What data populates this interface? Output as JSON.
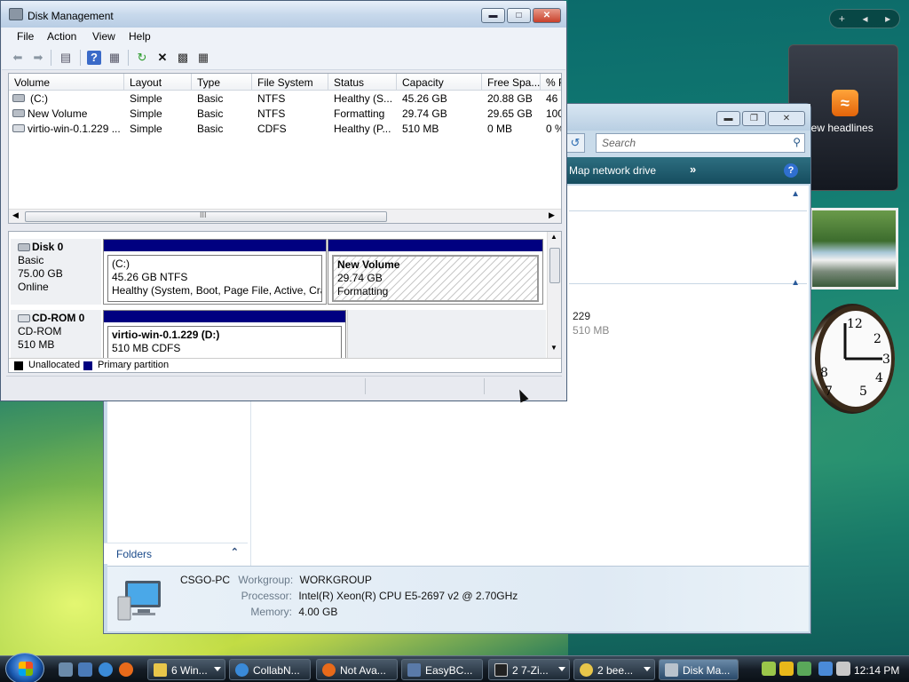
{
  "sidebar": {
    "controls": {
      "add": "+",
      "prev": "◂",
      "next": "▸"
    },
    "news_label": "iew headlines",
    "colors": {
      "rss": "#f08a1a"
    }
  },
  "explorer": {
    "search_placeholder": "Search",
    "map_network": "Map network drive",
    "more": "»",
    "help": "?",
    "drive_line1": "229",
    "drive_line2": "510 MB",
    "folders_label": "Folders",
    "details": {
      "name": "CSGO-PC",
      "workgroup_label": "Workgroup:",
      "workgroup": "WORKGROUP",
      "processor_label": "Processor:",
      "processor": "Intel(R) Xeon(R) CPU E5-2697 v2 @ 2.70GHz",
      "memory_label": "Memory:",
      "memory": "4.00 GB"
    }
  },
  "disk_mgmt": {
    "title": "Disk Management",
    "menu": [
      "File",
      "Action",
      "View",
      "Help"
    ],
    "toolbar_icons": [
      "back-icon",
      "forward-icon",
      "up-pane-icon",
      "help-icon",
      "view-icon",
      "refresh-icon",
      "delete-icon",
      "properties-icon",
      "rescan-icon"
    ],
    "columns": [
      "Volume",
      "Layout",
      "Type",
      "File System",
      "Status",
      "Capacity",
      "Free Spa...",
      "% F"
    ],
    "volumes": [
      {
        "volume": "(C:)",
        "layout": "Simple",
        "type": "Basic",
        "fs": "NTFS",
        "status": "Healthy (S...",
        "capacity": "45.26 GB",
        "free": "20.88 GB",
        "pct": "46"
      },
      {
        "volume": "New Volume",
        "layout": "Simple",
        "type": "Basic",
        "fs": "NTFS",
        "status": "Formatting",
        "capacity": "29.74 GB",
        "free": "29.65 GB",
        "pct": "100"
      },
      {
        "volume": "virtio-win-0.1.229 ...",
        "layout": "Simple",
        "type": "Basic",
        "fs": "CDFS",
        "status": "Healthy (P...",
        "capacity": "510 MB",
        "free": "0 MB",
        "pct": "0 %"
      }
    ],
    "scroll_grip": "III",
    "disks": [
      {
        "name": "Disk 0",
        "kind": "Basic",
        "size": "75.00 GB",
        "state": "Online"
      },
      {
        "name": "CD-ROM 0",
        "kind": "CD-ROM",
        "size": "510 MB",
        "state": ""
      }
    ],
    "partitions": {
      "c": {
        "title": "(C:)",
        "line2": "45.26 GB NTFS",
        "line3": "Healthy (System, Boot, Page File, Active, Cras"
      },
      "newvol": {
        "title": "New Volume",
        "line2": "29.74 GB",
        "line3": "Formatting"
      },
      "cd": {
        "title": "virtio-win-0.1.229  (D:)",
        "line2": "510 MB CDFS"
      }
    },
    "legend": [
      {
        "label": "Unallocated",
        "color": "#000000"
      },
      {
        "label": "Primary partition",
        "color": "#000080"
      }
    ]
  },
  "taskbar": {
    "buttons": [
      {
        "label": "6 Win...",
        "has_arrow": true
      },
      {
        "label": "CollabN...",
        "has_arrow": false
      },
      {
        "label": "Not Ava...",
        "has_arrow": false
      },
      {
        "label": "EasyBC...",
        "has_arrow": false
      },
      {
        "label": "2 7-Zi...",
        "has_arrow": true
      },
      {
        "label": "2 bee...",
        "has_arrow": true
      },
      {
        "label": "Disk Ma...",
        "has_arrow": false
      }
    ],
    "clock": "12:14 PM"
  }
}
